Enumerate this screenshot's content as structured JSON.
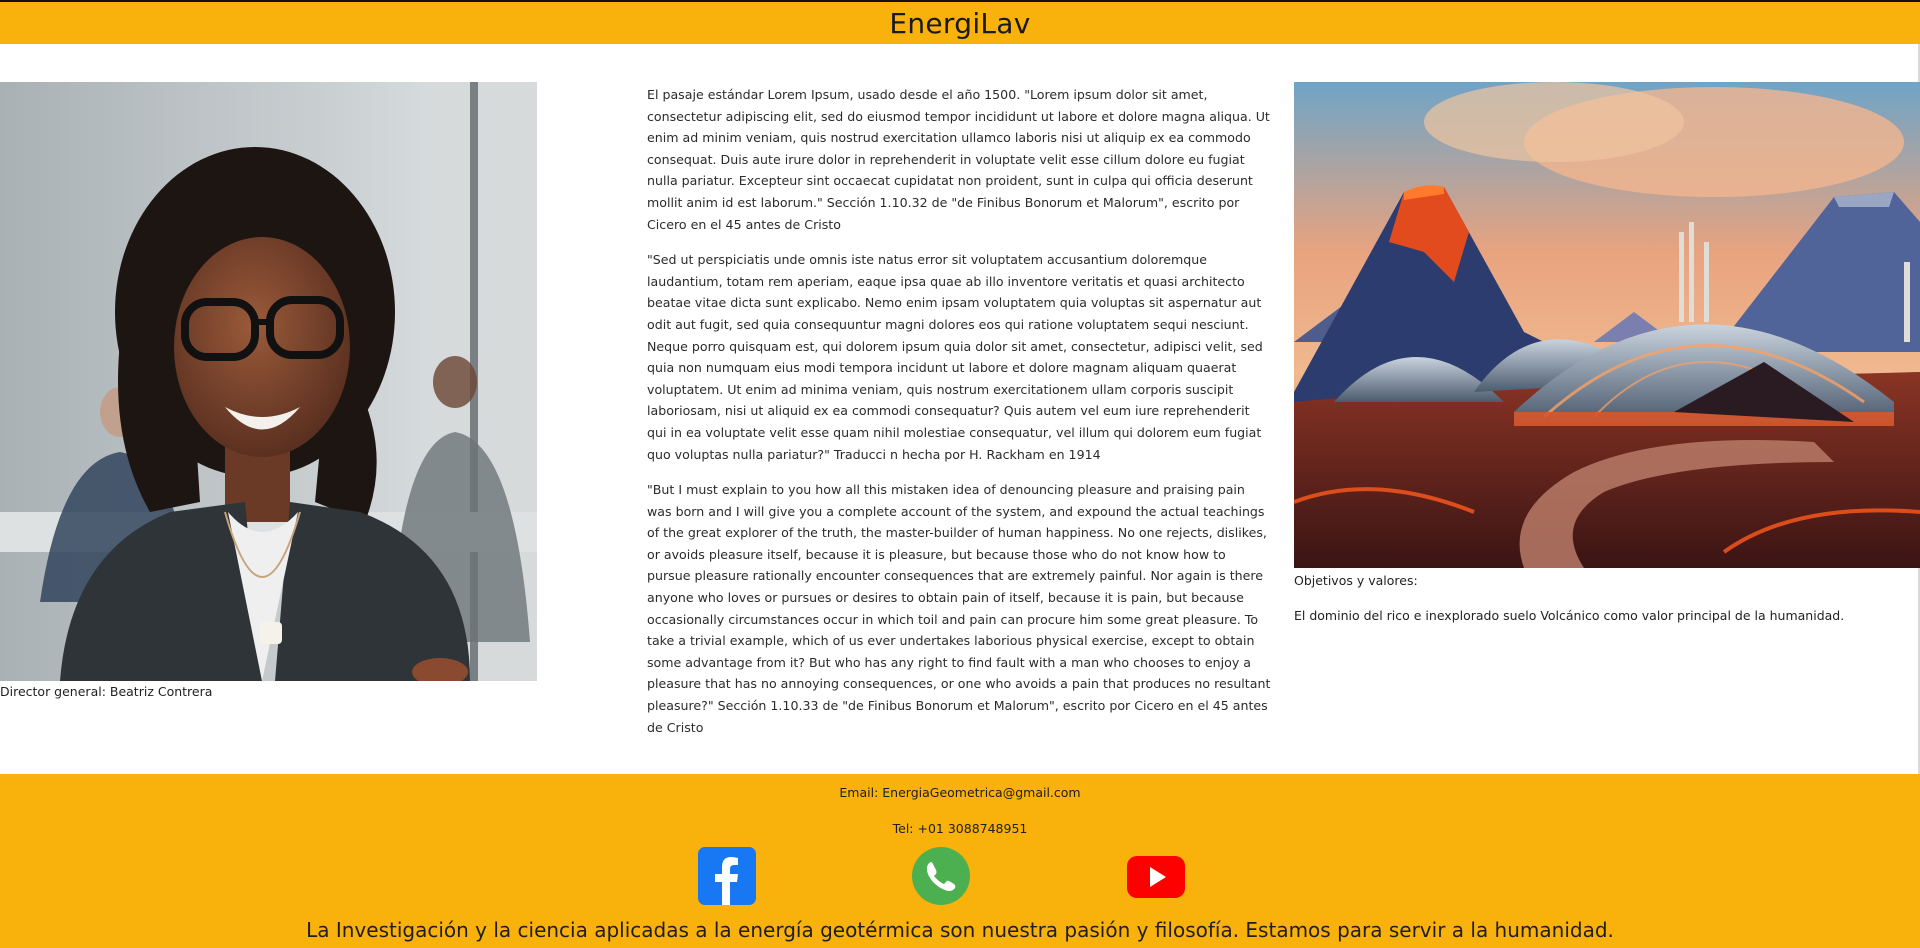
{
  "header": {
    "title": "EnergiLav"
  },
  "left": {
    "photo_icon": "portrait-photo",
    "caption": "Director general: Beatriz Contrera"
  },
  "article": {
    "paragraphs": [
      "El pasaje estándar Lorem Ipsum, usado desde el año 1500. \"Lorem ipsum dolor sit amet, consectetur adipiscing elit, sed do eiusmod tempor incididunt ut labore et dolore magna aliqua. Ut enim ad minim veniam, quis nostrud exercitation ullamco laboris nisi ut aliquip ex ea commodo consequat. Duis aute irure dolor in reprehenderit in voluptate velit esse cillum dolore eu fugiat nulla pariatur. Excepteur sint occaecat cupidatat non proident, sunt in culpa qui officia deserunt mollit anim id est laborum.\" Sección 1.10.32 de \"de Finibus Bonorum et Malorum\", escrito por Cicero en el 45 antes de Cristo",
      "\"Sed ut perspiciatis unde omnis iste natus error sit voluptatem accusantium doloremque laudantium, totam rem aperiam, eaque ipsa quae ab illo inventore veritatis et quasi architecto beatae vitae dicta sunt explicabo. Nemo enim ipsam voluptatem quia voluptas sit aspernatur aut odit aut fugit, sed quia consequuntur magni dolores eos qui ratione voluptatem sequi nesciunt. Neque porro quisquam est, qui dolorem ipsum quia dolor sit amet, consectetur, adipisci velit, sed quia non numquam eius modi tempora incidunt ut labore et dolore magnam aliquam quaerat voluptatem. Ut enim ad minima veniam, quis nostrum exercitationem ullam corporis suscipit laboriosam, nisi ut aliquid ex ea commodi consequatur? Quis autem vel eum iure reprehenderit qui in ea voluptate velit esse quam nihil molestiae consequatur, vel illum qui dolorem eum fugiat quo voluptas nulla pariatur?\" Traducci n hecha por H. Rackham en 1914",
      "\"But I must explain to you how all this mistaken idea of denouncing pleasure and praising pain was born and I will give you a complete account of the system, and expound the actual teachings of the great explorer of the truth, the master-builder of human happiness. No one rejects, dislikes, or avoids pleasure itself, because it is pleasure, but because those who do not know how to pursue pleasure rationally encounter consequences that are extremely painful. Nor again is there anyone who loves or pursues or desires to obtain pain of itself, because it is pain, but because occasionally circumstances occur in which toil and pain can procure him some great pleasure. To take a trivial example, which of us ever undertakes laborious physical exercise, except to obtain some advantage from it? But who has any right to find fault with a man who chooses to enjoy a pleasure that has no annoying consequences, or one who avoids a pain that produces no resultant pleasure?\" Sección 1.10.33 de \"de Finibus Bonorum et Malorum\", escrito por Cicero en el 45 antes de Cristo"
    ]
  },
  "right": {
    "photo_icon": "geothermal-plant-illustration",
    "caption_title": "Objetivos y valores:",
    "caption_text": "El dominio del rico e inexplorado suelo Volcánico como valor principal de la humanidad."
  },
  "footer": {
    "email": "Email: EnergiaGeometrica@gmail.com",
    "tel": "Tel: +01 3088748951",
    "social": [
      {
        "icon": "facebook-icon",
        "color": "#1877f2"
      },
      {
        "icon": "whatsapp-icon",
        "color": "#4caf50"
      },
      {
        "icon": "youtube-icon",
        "color": "#ff0000"
      }
    ],
    "slogan": "La Investigación y la ciencia aplicadas a la energía geotérmica son nuestra pasión y filosofía. Estamos para servir a la humanidad."
  },
  "colors": {
    "accent": "#f9b10c",
    "background": "#ffffff"
  }
}
